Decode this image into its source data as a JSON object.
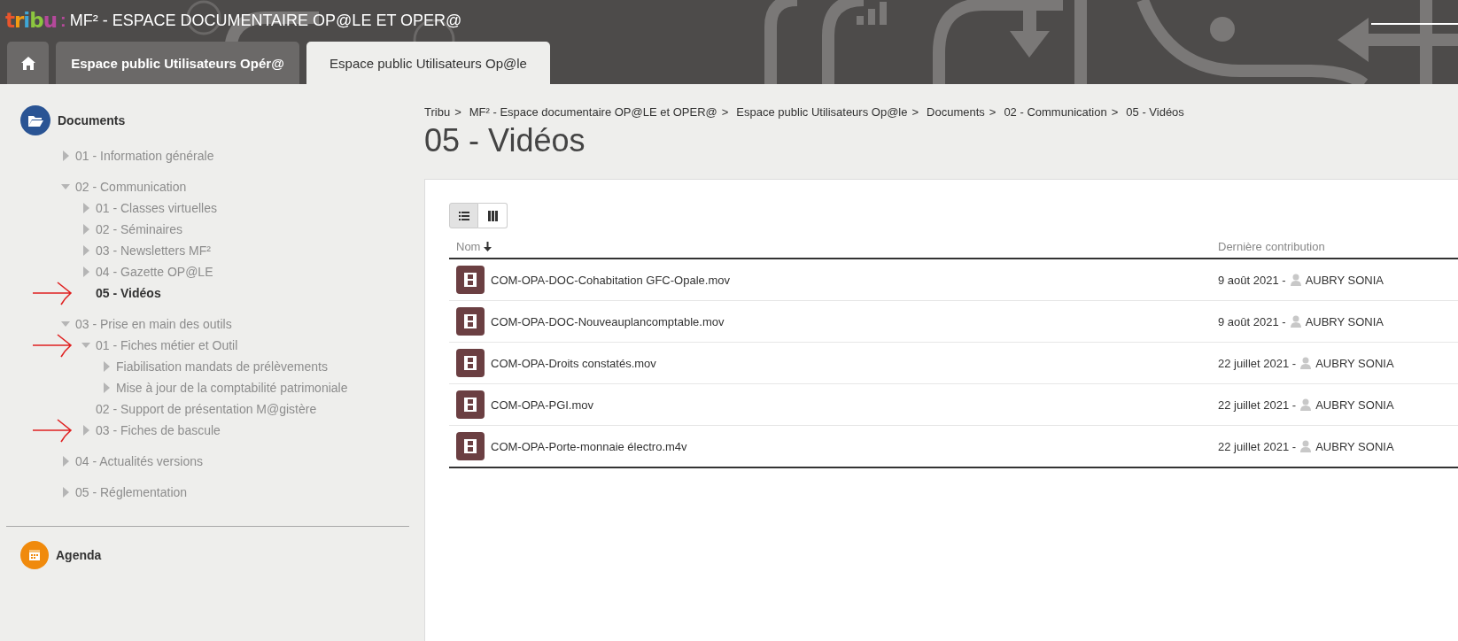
{
  "header": {
    "logo": "tribu",
    "separator": ":",
    "title": "MF² - ESPACE DOCUMENTAIRE OP@LE ET OPER@"
  },
  "tabs": [
    {
      "kind": "home",
      "selected": false
    },
    {
      "kind": "text",
      "label": "Espace public Utilisateurs Opér@",
      "selected": false
    },
    {
      "kind": "text",
      "label": "Espace public Utilisateurs Op@le",
      "selected": true
    }
  ],
  "sidebar": {
    "sections": [
      {
        "kind": "documents",
        "title": "Documents",
        "tree": [
          {
            "label": "01 - Information générale",
            "kind": "branch",
            "expanded": false,
            "selected": false,
            "marked": false
          },
          {
            "label": "02 - Communication",
            "kind": "branch",
            "expanded": true,
            "selected": false,
            "marked": false,
            "children": [
              {
                "label": "01 - Classes virtuelles",
                "kind": "branch",
                "expanded": false,
                "selected": false,
                "marked": false
              },
              {
                "label": "02 - Séminaires",
                "kind": "branch",
                "expanded": false,
                "selected": false,
                "marked": false
              },
              {
                "label": "03 - Newsletters MF²",
                "kind": "branch",
                "expanded": false,
                "selected": false,
                "marked": false
              },
              {
                "label": "04 - Gazette OP@LE",
                "kind": "branch",
                "expanded": false,
                "selected": false,
                "marked": false
              },
              {
                "label": "05 - Vidéos",
                "kind": "leaf",
                "selected": true,
                "marked": true
              }
            ]
          },
          {
            "label": "03 - Prise en main des outils",
            "kind": "branch",
            "expanded": true,
            "selected": false,
            "marked": false,
            "children": [
              {
                "label": "01 - Fiches métier et Outil",
                "kind": "branch",
                "expanded": true,
                "selected": false,
                "marked": true,
                "children": [
                  {
                    "label": "Fiabilisation mandats de prélèvements",
                    "kind": "branch",
                    "expanded": false,
                    "selected": false,
                    "marked": false
                  },
                  {
                    "label": "Mise à jour de la comptabilité patrimoniale",
                    "kind": "branch",
                    "expanded": false,
                    "selected": false,
                    "marked": false
                  }
                ]
              },
              {
                "label": "02 - Support de présentation M@gistère",
                "kind": "leaf",
                "selected": false,
                "marked": false
              },
              {
                "label": "03 - Fiches de bascule",
                "kind": "branch",
                "expanded": false,
                "selected": false,
                "marked": true
              }
            ]
          },
          {
            "label": "04 - Actualités versions",
            "kind": "branch",
            "expanded": false,
            "selected": false,
            "marked": false
          },
          {
            "label": "05 - Réglementation",
            "kind": "branch",
            "expanded": false,
            "selected": false,
            "marked": false
          }
        ]
      },
      {
        "kind": "agenda",
        "title": "Agenda"
      }
    ]
  },
  "breadcrumb": [
    "Tribu",
    "MF² - Espace documentaire OP@LE et OPER@",
    "Espace public Utilisateurs Op@le",
    "Documents",
    "02 - Communication",
    "05 - Vidéos"
  ],
  "breadcrumb_separator": ">",
  "page_title": "05 - Vidéos",
  "view_toggle": [
    {
      "kind": "list",
      "selected": true
    },
    {
      "kind": "columns",
      "selected": false
    }
  ],
  "table": {
    "columns": [
      {
        "label": "Nom",
        "sorted": true
      },
      {
        "label": "Dernière contribution",
        "sorted": false
      }
    ],
    "rows": [
      {
        "name": "COM-OPA-DOC-Cohabitation GFC-Opale.mov",
        "date": "9 août 2021 -",
        "author": "AUBRY SONIA"
      },
      {
        "name": "COM-OPA-DOC-Nouveauplancomptable.mov",
        "date": "9 août 2021 -",
        "author": "AUBRY SONIA"
      },
      {
        "name": "COM-OPA-Droits constatés.mov",
        "date": "22 juillet 2021 -",
        "author": "AUBRY SONIA"
      },
      {
        "name": "COM-OPA-PGI.mov",
        "date": "22 juillet 2021 -",
        "author": "AUBRY SONIA"
      },
      {
        "name": "COM-OPA-Porte-monnaie électro.m4v",
        "date": "22 juillet 2021 -",
        "author": "AUBRY SONIA"
      }
    ]
  }
}
